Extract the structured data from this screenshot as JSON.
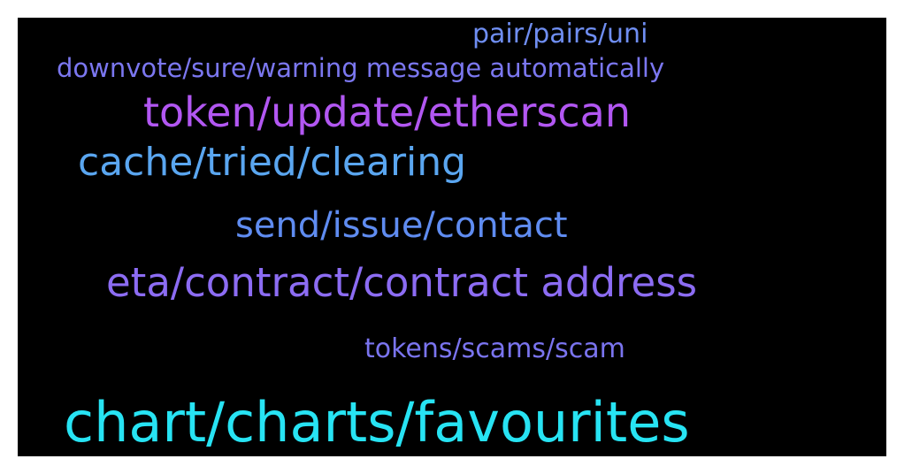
{
  "word_cloud": {
    "words": [
      {
        "text": "pair/pairs/uni",
        "color": "#6f8ef2"
      },
      {
        "text": "downvote/sure/warning message automatically",
        "color": "#7b77f0"
      },
      {
        "text": "token/update/etherscan",
        "color": "#b257f2"
      },
      {
        "text": "cache/tried/clearing",
        "color": "#5aa6f0"
      },
      {
        "text": "send/issue/contact",
        "color": "#5f8cf1"
      },
      {
        "text": "eta/contract/contract address",
        "color": "#8c6cf3"
      },
      {
        "text": "tokens/scams/scam",
        "color": "#7a74ef"
      },
      {
        "text": "chart/charts/favourites",
        "color": "#27e3f3"
      }
    ]
  }
}
